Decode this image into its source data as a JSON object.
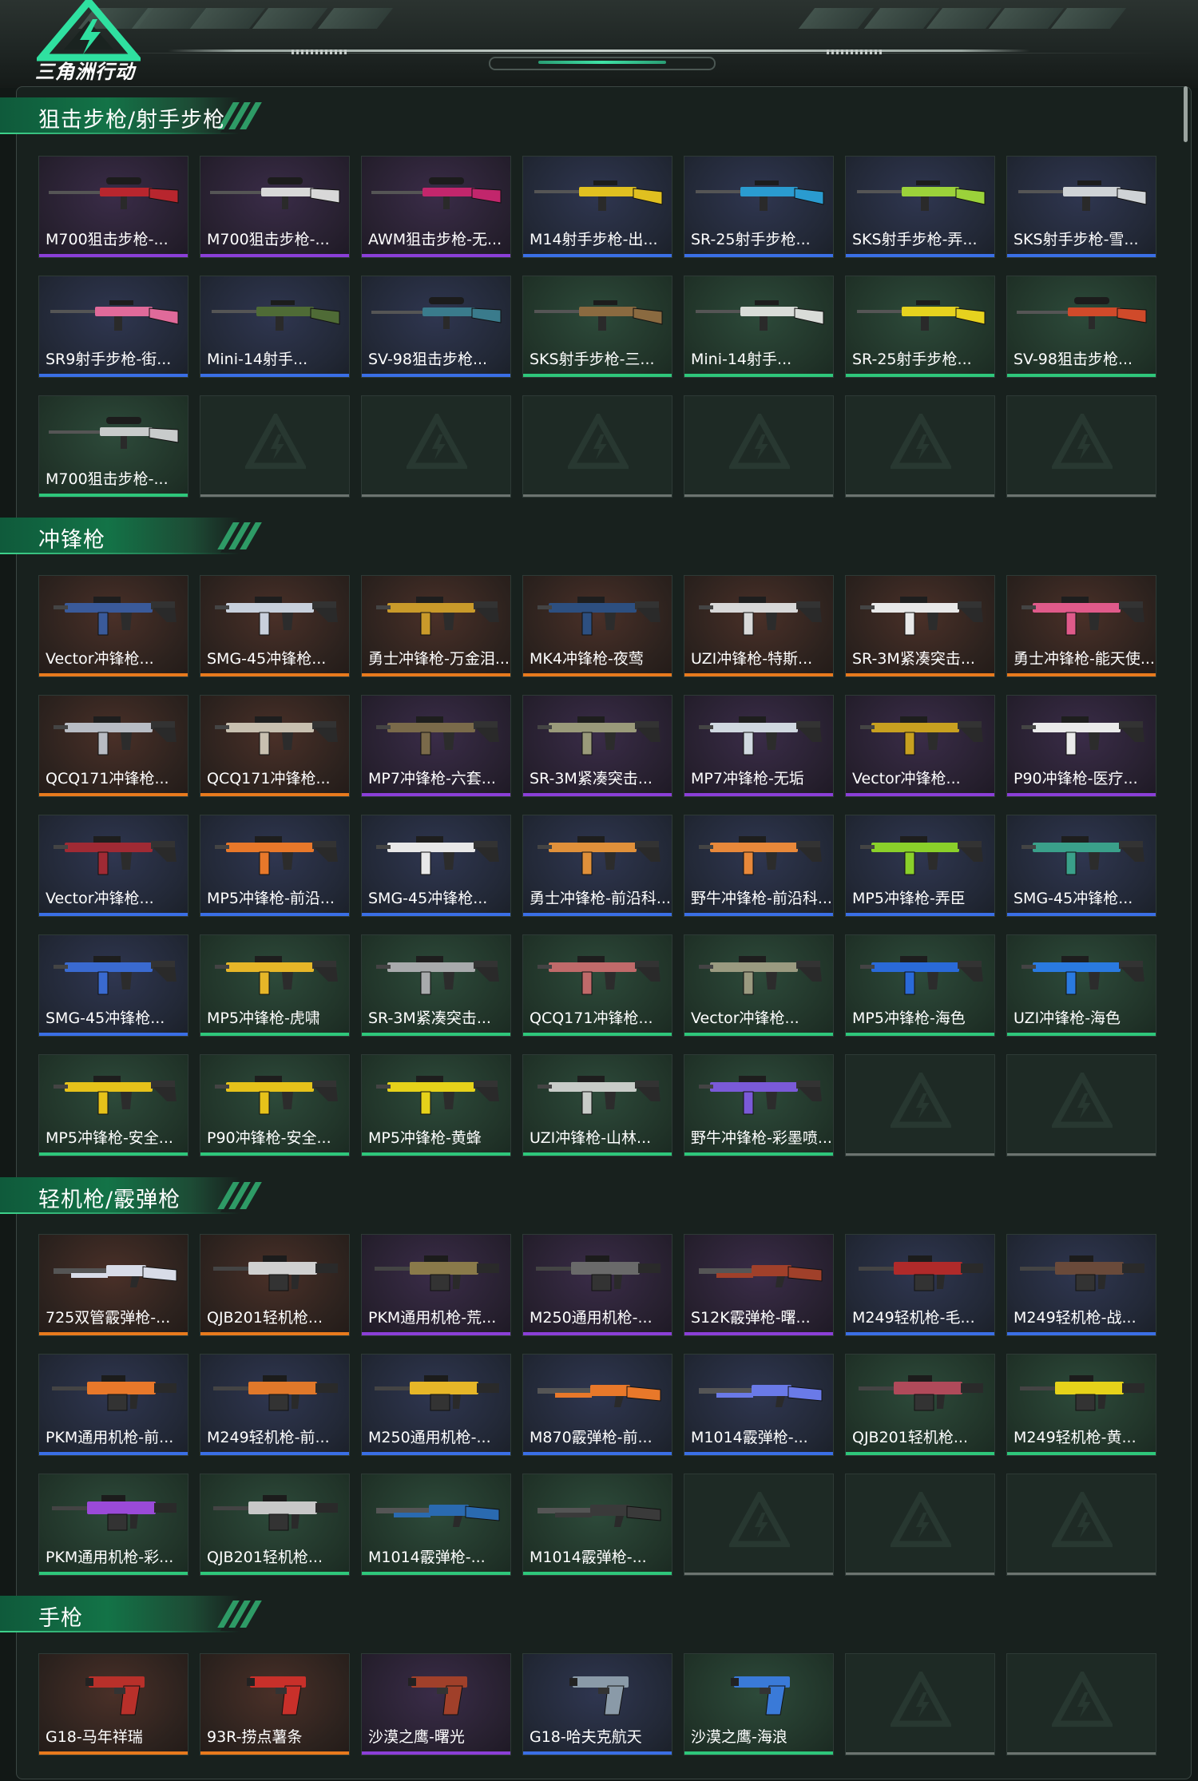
{
  "app": {
    "title": "三角洲行动"
  },
  "colors": {
    "orange": "#e87a1d",
    "purple": "#8b3fd8",
    "blue": "#3a6fe6",
    "green": "#2ec77b",
    "accent": "#3fe3a6"
  },
  "sections": [
    {
      "title": "狙击步枪/射手步枪",
      "items": [
        {
          "label": "M700狙击步枪-...",
          "rarity": "purple",
          "icon": "sniper-rifle-icon",
          "color": "#b8262e"
        },
        {
          "label": "M700狙击步枪-...",
          "rarity": "purple",
          "icon": "sniper-rifle-icon",
          "color": "#d8d8d8"
        },
        {
          "label": "AWM狙击步枪-无...",
          "rarity": "purple",
          "icon": "sniper-rifle-icon",
          "color": "#c2266c"
        },
        {
          "label": "M14射手步枪-出...",
          "rarity": "blue",
          "icon": "marksman-rifle-icon",
          "color": "#e0c020"
        },
        {
          "label": "SR-25射手步枪...",
          "rarity": "blue",
          "icon": "marksman-rifle-icon",
          "color": "#2a9bd0"
        },
        {
          "label": "SKS射手步枪-弄...",
          "rarity": "blue",
          "icon": "marksman-rifle-icon",
          "color": "#9bd23a"
        },
        {
          "label": "SKS射手步枪-雪...",
          "rarity": "blue",
          "icon": "marksman-rifle-icon",
          "color": "#cfd3d6"
        },
        {
          "label": "SR9射手步枪-街...",
          "rarity": "blue",
          "icon": "marksman-rifle-icon",
          "color": "#e06a9a"
        },
        {
          "label": "Mini-14射手...",
          "rarity": "blue",
          "icon": "marksman-rifle-icon",
          "color": "#4f6b36"
        },
        {
          "label": "SV-98狙击步枪...",
          "rarity": "blue",
          "icon": "sniper-rifle-icon",
          "color": "#3a7b8c"
        },
        {
          "label": "SKS射手步枪-三...",
          "rarity": "green",
          "icon": "marksman-rifle-icon",
          "color": "#8a6a40"
        },
        {
          "label": "Mini-14射手...",
          "rarity": "green",
          "icon": "marksman-rifle-icon",
          "color": "#d9dcd8"
        },
        {
          "label": "SR-25射手步枪...",
          "rarity": "green",
          "icon": "marksman-rifle-icon",
          "color": "#e6d21e"
        },
        {
          "label": "SV-98狙击步枪...",
          "rarity": "green",
          "icon": "sniper-rifle-icon",
          "color": "#d04a2a"
        },
        {
          "label": "M700狙击步枪-...",
          "rarity": "green",
          "icon": "sniper-rifle-icon",
          "color": "#c8cbcb"
        },
        {
          "label": "",
          "rarity": "empty"
        },
        {
          "label": "",
          "rarity": "empty"
        },
        {
          "label": "",
          "rarity": "empty"
        },
        {
          "label": "",
          "rarity": "empty"
        },
        {
          "label": "",
          "rarity": "empty"
        },
        {
          "label": "",
          "rarity": "empty"
        }
      ]
    },
    {
      "title": "冲锋枪",
      "items": [
        {
          "label": "Vector冲锋枪...",
          "rarity": "orange",
          "icon": "smg-icon",
          "color": "#3a5a9a"
        },
        {
          "label": "SMG-45冲锋枪...",
          "rarity": "orange",
          "icon": "smg-icon",
          "color": "#c8d0dc"
        },
        {
          "label": "勇士冲锋枪-万金泪...",
          "rarity": "orange",
          "icon": "smg-icon",
          "color": "#c99a2a"
        },
        {
          "label": "MK4冲锋枪-夜莺",
          "rarity": "orange",
          "icon": "smg-icon",
          "color": "#2d4f80"
        },
        {
          "label": "UZI冲锋枪-特斯...",
          "rarity": "orange",
          "icon": "smg-icon",
          "color": "#d8d8d8"
        },
        {
          "label": "SR-3M紧凑突击...",
          "rarity": "orange",
          "icon": "smg-icon",
          "color": "#e8e8e8"
        },
        {
          "label": "勇士冲锋枪-能天使...",
          "rarity": "orange",
          "icon": "smg-icon",
          "color": "#e05a8a"
        },
        {
          "label": "QCQ171冲锋枪...",
          "rarity": "orange",
          "icon": "smg-icon",
          "color": "#b8bcc4"
        },
        {
          "label": "QCQ171冲锋枪...",
          "rarity": "orange",
          "icon": "smg-icon",
          "color": "#c8c0b0"
        },
        {
          "label": "MP7冲锋枪-六套...",
          "rarity": "purple",
          "icon": "smg-icon",
          "color": "#7a6a4a"
        },
        {
          "label": "SR-3M紧凑突击...",
          "rarity": "purple",
          "icon": "smg-icon",
          "color": "#9a9a7a"
        },
        {
          "label": "MP7冲锋枪-无垢",
          "rarity": "purple",
          "icon": "smg-icon",
          "color": "#d0d8e0"
        },
        {
          "label": "Vector冲锋枪...",
          "rarity": "purple",
          "icon": "smg-icon",
          "color": "#c8a020"
        },
        {
          "label": "P90冲锋枪-医疗...",
          "rarity": "purple",
          "icon": "smg-icon",
          "color": "#eaeaea"
        },
        {
          "label": "Vector冲锋枪...",
          "rarity": "blue",
          "icon": "smg-icon",
          "color": "#a02a34"
        },
        {
          "label": "MP5冲锋枪-前沿...",
          "rarity": "blue",
          "icon": "smg-icon",
          "color": "#e8782a"
        },
        {
          "label": "SMG-45冲锋枪...",
          "rarity": "blue",
          "icon": "smg-icon",
          "color": "#e8e8e8"
        },
        {
          "label": "勇士冲锋枪-前沿科...",
          "rarity": "blue",
          "icon": "smg-icon",
          "color": "#e0903a"
        },
        {
          "label": "野牛冲锋枪-前沿科...",
          "rarity": "blue",
          "icon": "smg-icon",
          "color": "#e8883a"
        },
        {
          "label": "MP5冲锋枪-弄臣",
          "rarity": "blue",
          "icon": "smg-icon",
          "color": "#8ad02a"
        },
        {
          "label": "SMG-45冲锋枪...",
          "rarity": "blue",
          "icon": "smg-icon",
          "color": "#3aa08a"
        },
        {
          "label": "SMG-45冲锋枪...",
          "rarity": "blue",
          "icon": "smg-icon",
          "color": "#3a6ad0"
        },
        {
          "label": "MP5冲锋枪-虎啸",
          "rarity": "green",
          "icon": "smg-icon",
          "color": "#e6b628"
        },
        {
          "label": "SR-3M紧凑突击...",
          "rarity": "green",
          "icon": "smg-icon",
          "color": "#a8aaac"
        },
        {
          "label": "QCQ171冲锋枪...",
          "rarity": "green",
          "icon": "smg-icon",
          "color": "#c06a6a"
        },
        {
          "label": "Vector冲锋枪...",
          "rarity": "green",
          "icon": "smg-icon",
          "color": "#9a9a80"
        },
        {
          "label": "MP5冲锋枪-海色",
          "rarity": "green",
          "icon": "smg-icon",
          "color": "#2a6ad8"
        },
        {
          "label": "UZI冲锋枪-海色",
          "rarity": "green",
          "icon": "smg-icon",
          "color": "#2a7ae0"
        },
        {
          "label": "MP5冲锋枪-安全...",
          "rarity": "green",
          "icon": "smg-icon",
          "color": "#e6c21a"
        },
        {
          "label": "P90冲锋枪-安全...",
          "rarity": "green",
          "icon": "smg-icon",
          "color": "#e6c21a"
        },
        {
          "label": "MP5冲锋枪-黄蜂",
          "rarity": "green",
          "icon": "smg-icon",
          "color": "#e6d21a"
        },
        {
          "label": "UZI冲锋枪-山林...",
          "rarity": "green",
          "icon": "smg-icon",
          "color": "#c8ccc8"
        },
        {
          "label": "野牛冲锋枪-彩墨喷...",
          "rarity": "green",
          "icon": "smg-icon",
          "color": "#7a5ad8"
        },
        {
          "label": "",
          "rarity": "empty"
        },
        {
          "label": "",
          "rarity": "empty"
        }
      ]
    },
    {
      "title": "轻机枪/霰弹枪",
      "items": [
        {
          "label": "725双管霰弹枪-...",
          "rarity": "orange",
          "icon": "shotgun-icon",
          "color": "#d8dce8"
        },
        {
          "label": "QJB201轻机枪...",
          "rarity": "orange",
          "icon": "lmg-icon",
          "color": "#d0d0d0"
        },
        {
          "label": "PKM通用机枪-荒...",
          "rarity": "purple",
          "icon": "lmg-icon",
          "color": "#8a7a4a"
        },
        {
          "label": "M250通用机枪-...",
          "rarity": "purple",
          "icon": "lmg-icon",
          "color": "#6a6a6a"
        },
        {
          "label": "S12K霰弹枪-曙...",
          "rarity": "purple",
          "icon": "shotgun-icon",
          "color": "#a0402a"
        },
        {
          "label": "M249轻机枪-毛...",
          "rarity": "blue",
          "icon": "lmg-icon",
          "color": "#b02a2a"
        },
        {
          "label": "M249轻机枪-战...",
          "rarity": "blue",
          "icon": "lmg-icon",
          "color": "#6a4a3a"
        },
        {
          "label": "PKM通用机枪-前...",
          "rarity": "blue",
          "icon": "lmg-icon",
          "color": "#e8782a"
        },
        {
          "label": "M249轻机枪-前...",
          "rarity": "blue",
          "icon": "lmg-icon",
          "color": "#e0782a"
        },
        {
          "label": "M250通用机枪-...",
          "rarity": "blue",
          "icon": "lmg-icon",
          "color": "#e6b628"
        },
        {
          "label": "M870霰弹枪-前...",
          "rarity": "blue",
          "icon": "shotgun-icon",
          "color": "#e8782a"
        },
        {
          "label": "M1014霰弹枪-...",
          "rarity": "blue",
          "icon": "shotgun-icon",
          "color": "#6a7ae8"
        },
        {
          "label": "QJB201轻机枪...",
          "rarity": "green",
          "icon": "lmg-icon",
          "color": "#b04a5a"
        },
        {
          "label": "M249轻机枪-黄...",
          "rarity": "green",
          "icon": "lmg-icon",
          "color": "#e6d21a"
        },
        {
          "label": "PKM通用机枪-彩...",
          "rarity": "green",
          "icon": "lmg-icon",
          "color": "#9a4ad8"
        },
        {
          "label": "QJB201轻机枪...",
          "rarity": "green",
          "icon": "lmg-icon",
          "color": "#c8c8c8"
        },
        {
          "label": "M1014霰弹枪-...",
          "rarity": "green",
          "icon": "shotgun-icon",
          "color": "#2a6ab0"
        },
        {
          "label": "M1014霰弹枪-...",
          "rarity": "green",
          "icon": "shotgun-icon",
          "color": "#3a3a3a"
        },
        {
          "label": "",
          "rarity": "empty"
        },
        {
          "label": "",
          "rarity": "empty"
        },
        {
          "label": "",
          "rarity": "empty"
        }
      ]
    },
    {
      "title": "手枪",
      "items": [
        {
          "label": "G18-马年祥瑞",
          "rarity": "orange",
          "icon": "pistol-icon",
          "color": "#b8302a"
        },
        {
          "label": "93R-捞点薯条",
          "rarity": "orange",
          "icon": "pistol-icon",
          "color": "#c8302a"
        },
        {
          "label": "沙漠之鹰-曙光",
          "rarity": "purple",
          "icon": "pistol-icon",
          "color": "#a0402a"
        },
        {
          "label": "G18-哈夫克航天",
          "rarity": "blue",
          "icon": "pistol-icon",
          "color": "#8a9aa8"
        },
        {
          "label": "沙漠之鹰-海浪",
          "rarity": "green",
          "icon": "pistol-icon",
          "color": "#3a7ad8"
        },
        {
          "label": "",
          "rarity": "empty"
        },
        {
          "label": "",
          "rarity": "empty"
        }
      ]
    }
  ]
}
